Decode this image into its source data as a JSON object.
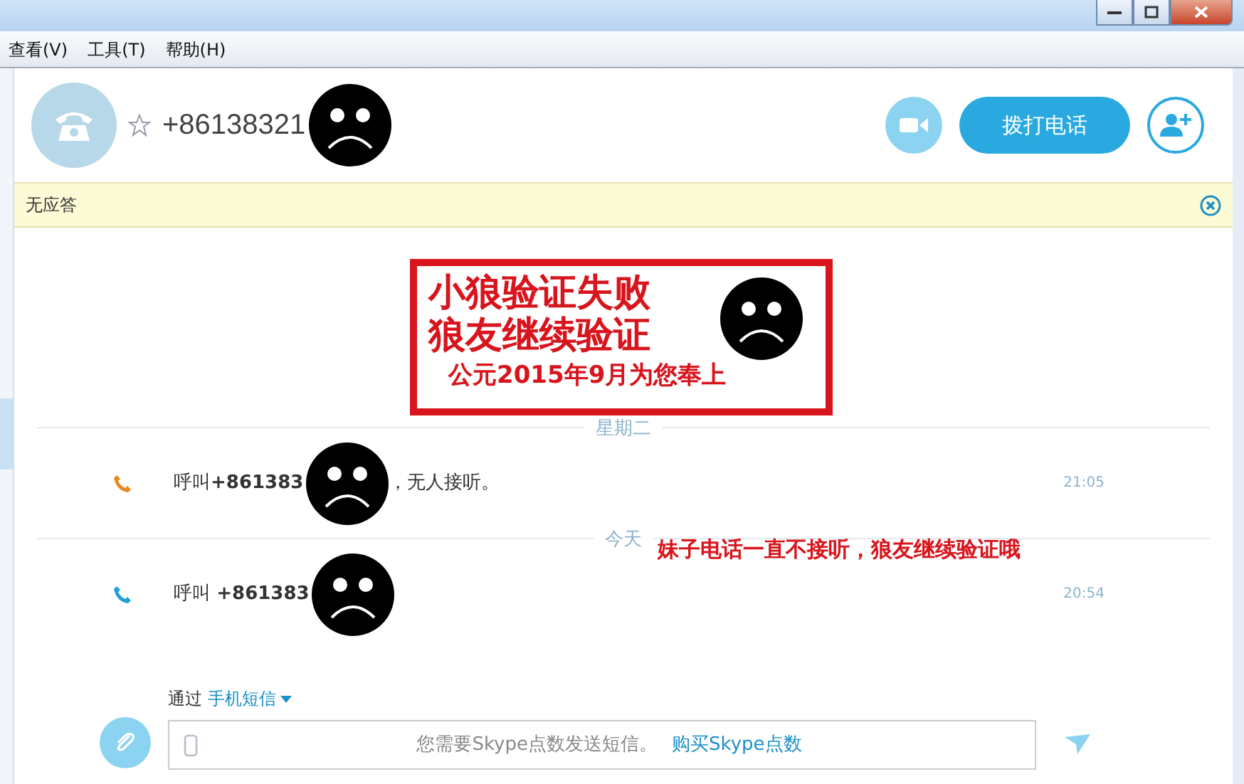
{
  "menu": [
    "查看(V)",
    "工具(T)",
    "帮助(H)"
  ],
  "contact": {
    "name": "+86138321",
    "favorite": false,
    "redacted": true
  },
  "actions": {
    "call_button": "拨打电话"
  },
  "notice": {
    "text": "无应答"
  },
  "stamp": {
    "lines": [
      "小狼验证失败",
      "狼友继续验证",
      "公元2015年9月为您奉上"
    ]
  },
  "history": [
    {
      "kind": "divider",
      "label": "星期二"
    },
    {
      "kind": "call",
      "color": "#e8891c",
      "text": "呼叫**+861383**",
      "redacted": true,
      "suffix": "，无人接听。",
      "time": "21:05"
    },
    {
      "kind": "divider",
      "label": "今天"
    },
    {
      "kind": "call",
      "color": "#1ea0d8",
      "text": "呼叫 **+861383**",
      "redacted": true,
      "time": "20:54"
    }
  ],
  "caption": "妹子电话一直不接听，狼友继续验证哦",
  "composer": {
    "via": "通过",
    "channel": "手机短信",
    "message": "您需要Skype点数发送短信。",
    "link": "购买Skype点数"
  }
}
